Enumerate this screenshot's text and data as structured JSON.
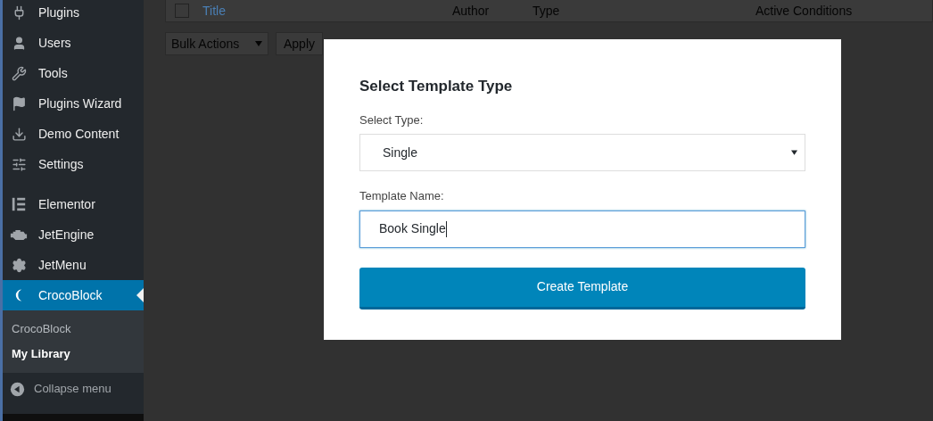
{
  "sidebar": {
    "items": [
      {
        "label": "Plugins",
        "selected": false
      },
      {
        "label": "Users",
        "selected": false
      },
      {
        "label": "Tools",
        "selected": false
      },
      {
        "label": "Plugins Wizard",
        "selected": false
      },
      {
        "label": "Demo Content",
        "selected": false
      },
      {
        "label": "Settings",
        "selected": false
      },
      {
        "label": "Elementor",
        "selected": false
      },
      {
        "label": "JetEngine",
        "selected": false
      },
      {
        "label": "JetMenu",
        "selected": false
      },
      {
        "label": "CrocoBlock",
        "selected": true
      }
    ],
    "submenu": [
      {
        "label": "CrocoBlock",
        "selected": false
      },
      {
        "label": "My Library",
        "selected": true
      }
    ],
    "collapse": "Collapse menu"
  },
  "table": {
    "select_all_checked": false,
    "columns": [
      "Title",
      "Author",
      "Type",
      "Active Conditions"
    ]
  },
  "bulk_actions": {
    "value": "Bulk Actions",
    "apply": "Apply"
  },
  "modal": {
    "title": "Select Template Type",
    "type_label": "Select Type:",
    "type_value": "Single",
    "name_label": "Template Name:",
    "name_value": "Book Single",
    "submit": "Create Template"
  }
}
